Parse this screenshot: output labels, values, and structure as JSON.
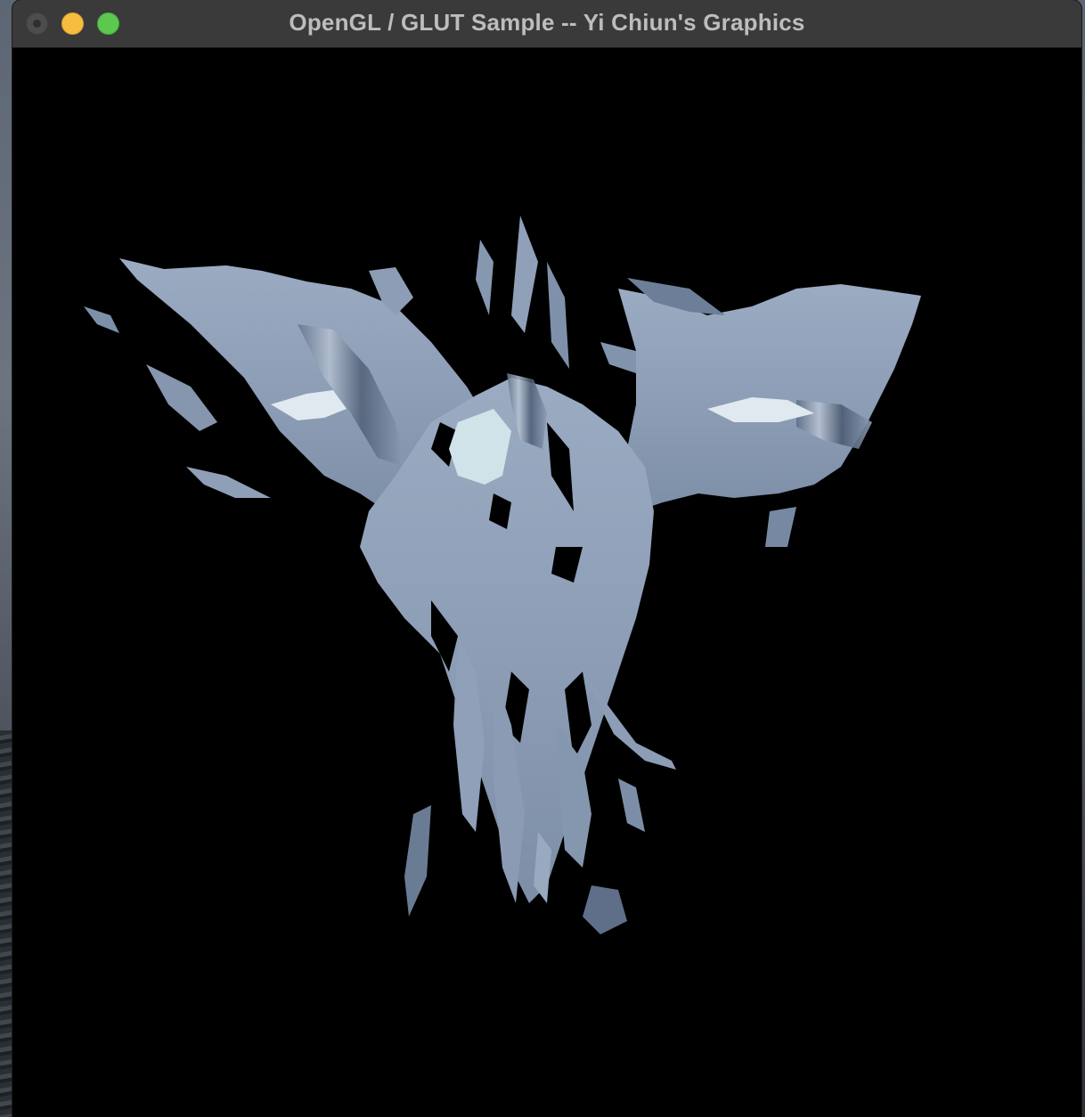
{
  "window": {
    "title": "OpenGL / GLUT Sample -- Yi Chiun's Graphics"
  },
  "titlebar_buttons": {
    "close_icon": "close-circle-icon",
    "minimize_icon": "minimize-circle-icon",
    "zoom_icon": "zoom-circle-icon"
  },
  "colors": {
    "canvas_background": "#000000",
    "model_surface": "#8fa0b8",
    "model_highlight": "#dceaf0",
    "model_shadow": "#3b4a63",
    "minimize": "#f6bd3f",
    "zoom": "#5cc84e"
  },
  "canvas": {
    "content": "textured 3D bird model rendered on black background"
  }
}
